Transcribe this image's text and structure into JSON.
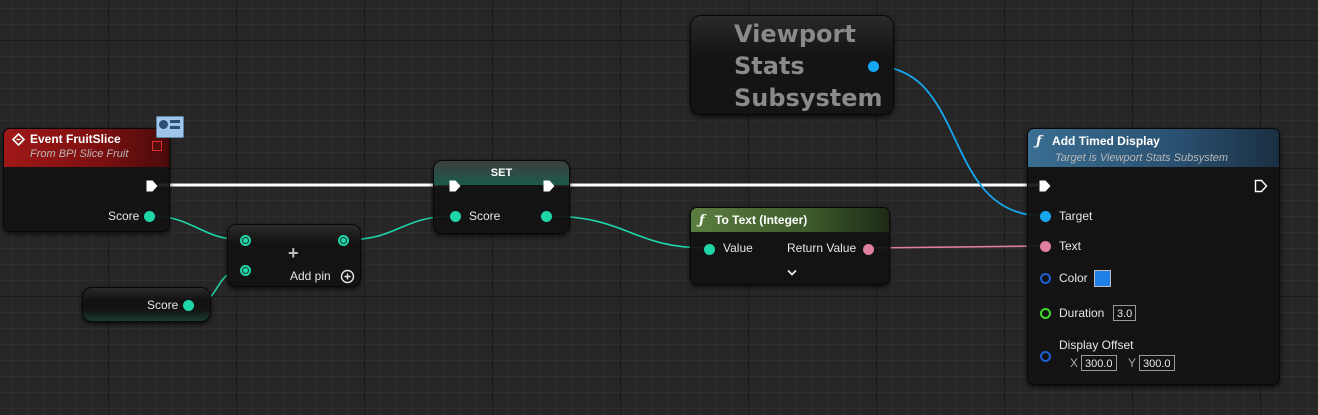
{
  "nodes": {
    "event": {
      "title": "Event FruitSlice",
      "subtitle": "From BPI Slice Fruit",
      "out_pin": "Score",
      "header_color": "#8a1414"
    },
    "getter": {
      "label": "Score"
    },
    "add": {
      "add_pin_label": "Add pin"
    },
    "set": {
      "title": "SET",
      "pin": "Score",
      "header_color": "#1c5b4d"
    },
    "viewport": {
      "title_lines": [
        "Viewport",
        "Stats",
        "Subsystem"
      ]
    },
    "to_text": {
      "title": "To Text (Integer)",
      "in_pin": "Value",
      "out_pin": "Return Value",
      "header_color": "#4c6e35"
    },
    "timed": {
      "title": "Add Timed Display",
      "subtitle": "Target is Viewport Stats Subsystem",
      "header_color": "#2e5a78",
      "pins": {
        "target": "Target",
        "text": "Text",
        "color": "Color",
        "duration": "Duration",
        "offset": "Display Offset"
      },
      "duration_value": "3.0",
      "offset_x_label": "X",
      "offset_x": "300.0",
      "offset_y_label": "Y",
      "offset_y": "300.0",
      "color_swatch": "#1f7fe6"
    }
  },
  "colors": {
    "integer": "#1ed6a8",
    "object": "#16a7f0",
    "text": "#e07fa1",
    "exec": "#ffffff",
    "struct": "#1e5fcf",
    "float": "#3fd92c"
  }
}
